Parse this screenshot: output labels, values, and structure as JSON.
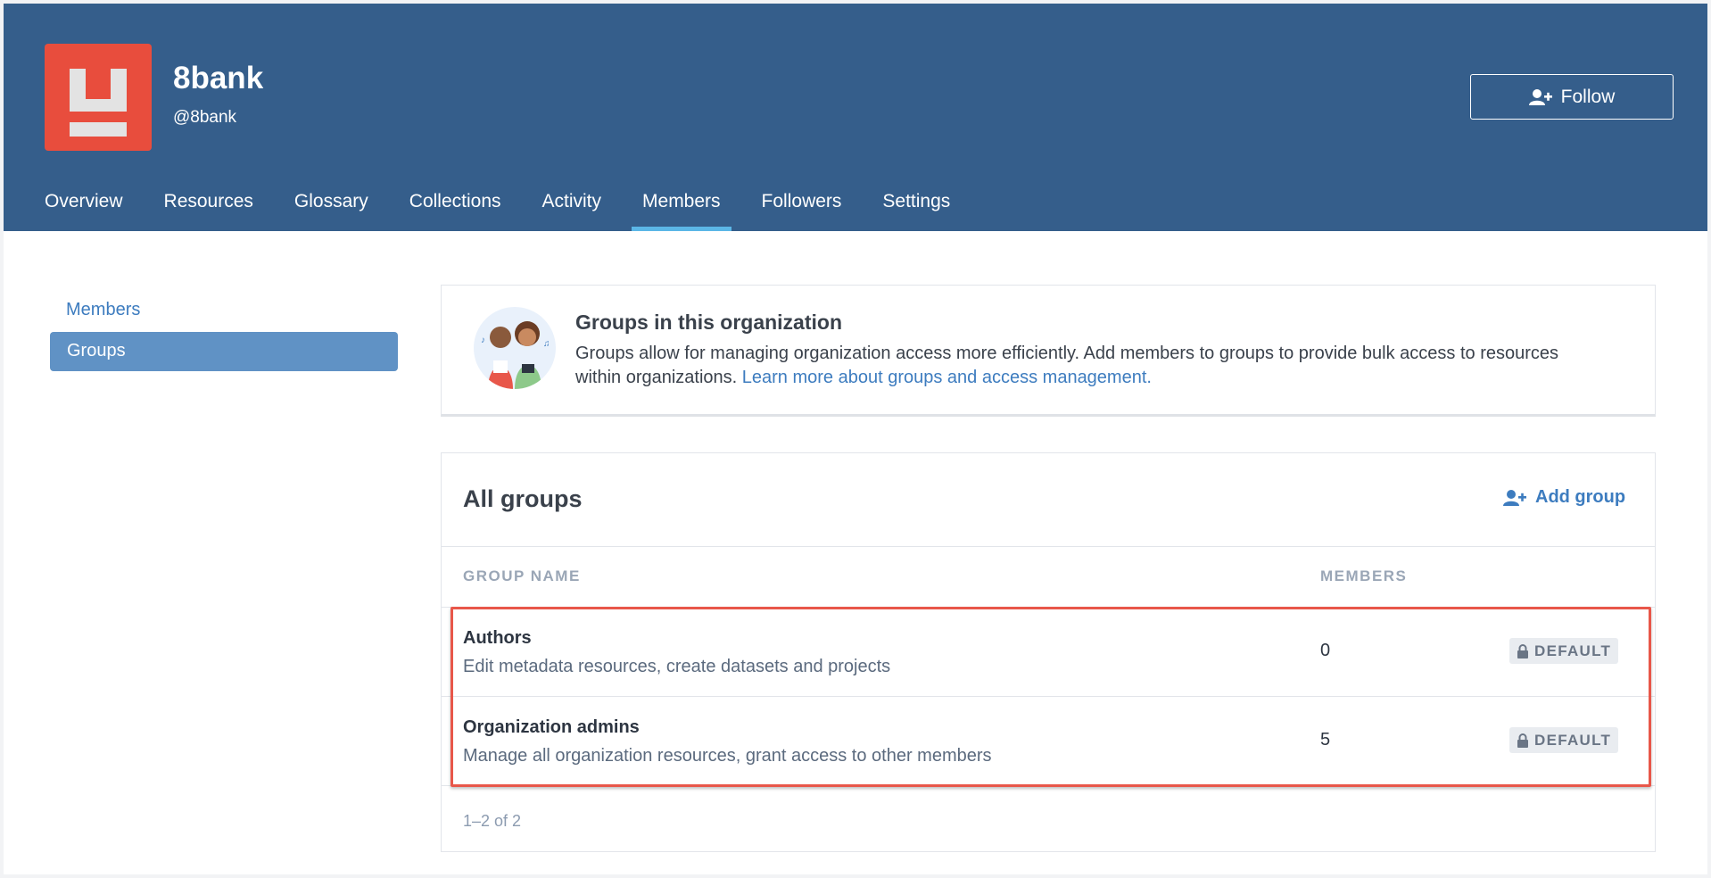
{
  "org": {
    "name": "8bank",
    "handle": "@8bank",
    "follow_label": "Follow"
  },
  "nav_tabs": [
    "Overview",
    "Resources",
    "Glossary",
    "Collections",
    "Activity",
    "Members",
    "Followers",
    "Settings"
  ],
  "active_tab": "Members",
  "sidebar": {
    "items": [
      "Members",
      "Groups"
    ],
    "active": "Groups"
  },
  "info": {
    "title": "Groups in this organization",
    "text": "Groups allow for managing organization access more efficiently. Add members to groups to provide bulk access to resources within organizations.",
    "link": "Learn more about groups and access management."
  },
  "groups": {
    "title": "All groups",
    "add_label": "Add group",
    "columns": [
      "GROUP NAME",
      "MEMBERS"
    ],
    "rows": [
      {
        "name": "Authors",
        "description": "Edit metadata resources, create datasets and projects",
        "members": "0",
        "badge": "DEFAULT"
      },
      {
        "name": "Organization admins",
        "description": "Manage all organization resources, grant access to other members",
        "members": "5",
        "badge": "DEFAULT"
      }
    ],
    "pagination": "1–2 of 2"
  },
  "colors": {
    "header_bg": "#355e8b",
    "logo_bg": "#e84d3d",
    "accent": "#3d7cbf",
    "tab_underline": "#5bb6e6",
    "highlight": "#e8574a"
  },
  "icons": {
    "follow": "user-plus-icon",
    "add_group": "user-plus-icon",
    "badge": "lock-icon"
  }
}
